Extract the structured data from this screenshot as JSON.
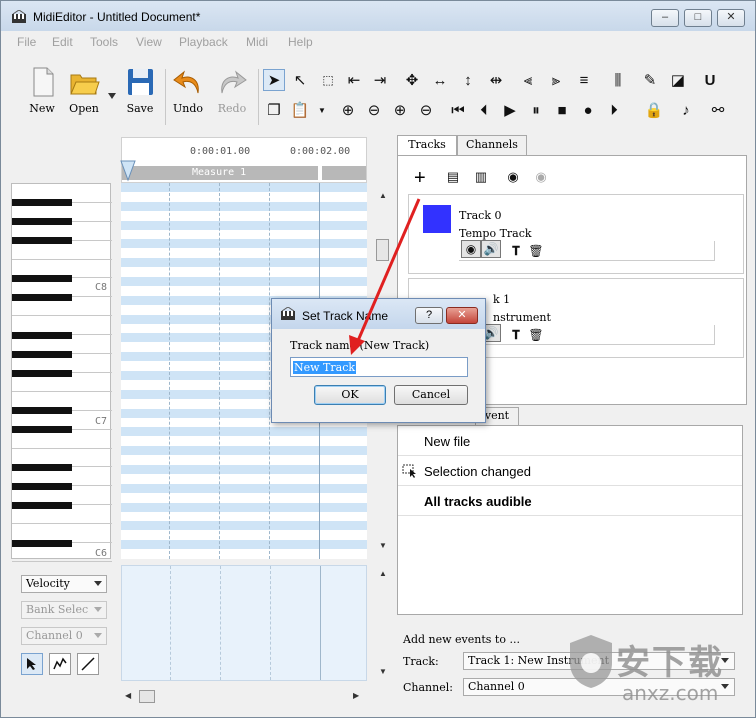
{
  "window": {
    "title": "MidiEditor - Untitled Document*",
    "controls": [
      "–",
      "□",
      "✕"
    ]
  },
  "menu": [
    "File",
    "Edit",
    "Tools",
    "View",
    "Playback",
    "Midi",
    "Help"
  ],
  "toolbar": {
    "new_label": "New",
    "open_label": "Open",
    "save_label": "Save",
    "undo_label": "Undo",
    "redo_label": "Redo"
  },
  "timeline": {
    "ticks": [
      "0:00:01.00",
      "0:00:02.00"
    ],
    "measure": "Measure 1"
  },
  "keys": {
    "labels": [
      "C8",
      "C7",
      "C6"
    ]
  },
  "left_controls": {
    "velocity": "Velocity",
    "bank_select": "Bank Selec",
    "channel": "Channel 0"
  },
  "tabs": {
    "tracks": "Tracks",
    "channels": "Channels",
    "event": "vent"
  },
  "tracks": [
    {
      "name": "Track 0",
      "sub": "Tempo Track",
      "color": "#3232ff"
    },
    {
      "name": "k 1",
      "sub": "nstrument",
      "color": ""
    }
  ],
  "protocol": [
    {
      "text": "New file",
      "bold": false,
      "icon": ""
    },
    {
      "text": "Selection changed",
      "bold": false,
      "icon": "selection-icon"
    },
    {
      "text": "All tracks audible",
      "bold": true,
      "icon": ""
    }
  ],
  "add_events": {
    "heading": "Add new events to ...",
    "track_label": "Track:",
    "track_value": "Track 1: New Instrument",
    "channel_label": "Channel:",
    "channel_value": "Channel 0"
  },
  "dialog": {
    "title": "Set Track Name",
    "help": "?",
    "close": "✕",
    "prompt": "Track name (New Track)",
    "value": "New Track",
    "ok": "OK",
    "cancel": "Cancel"
  },
  "watermark": {
    "text": "安下载",
    "sub": "anxz.com"
  },
  "colors": {
    "grid_stripe": "#cfe4f6",
    "track0": "#3232ff",
    "arrow": "#e02020"
  }
}
